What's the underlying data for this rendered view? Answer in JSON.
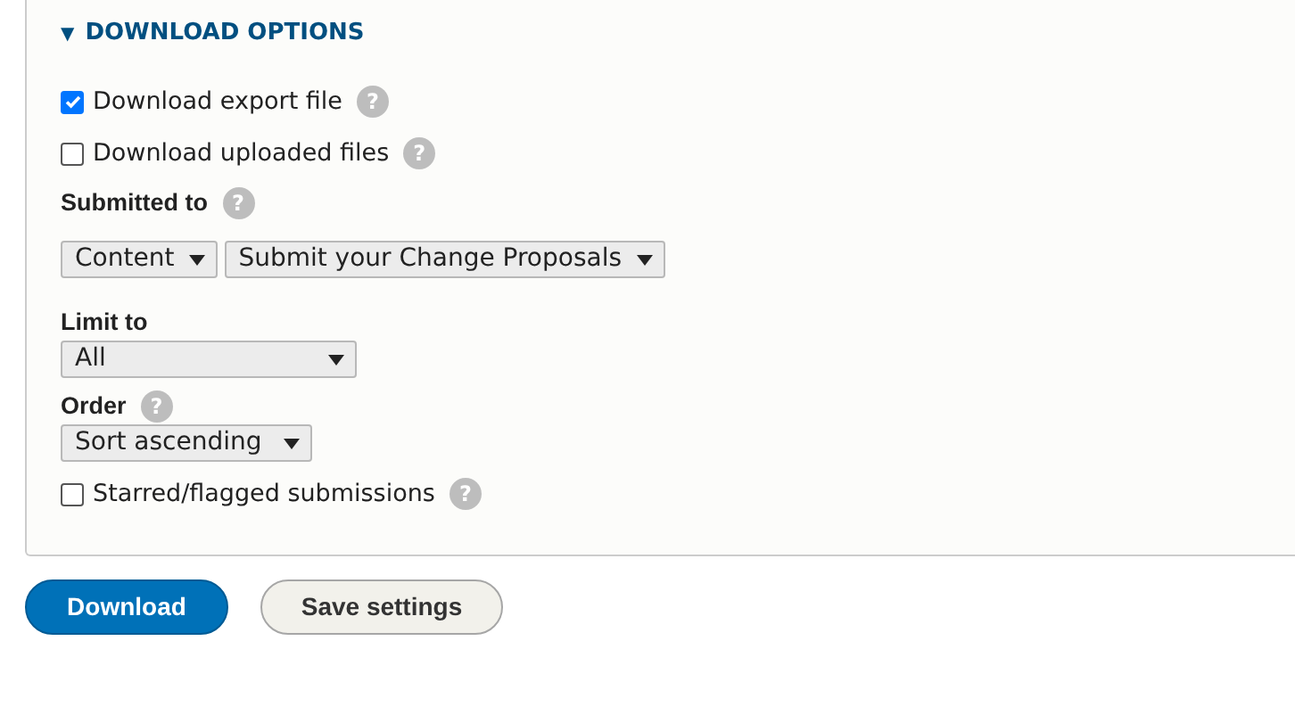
{
  "section": {
    "title": "DOWNLOAD OPTIONS",
    "expanded": true,
    "toggle": "▼"
  },
  "options": [
    {
      "kind": "checkbox",
      "label": "Download export file",
      "checked": true,
      "help": "?"
    },
    {
      "kind": "checkbox",
      "label": "Download uploaded files",
      "checked": false,
      "help": "?"
    },
    {
      "kind": "selects",
      "label": "Submitted to",
      "help": "?",
      "selects": [
        "Content",
        "Submit your Change Proposals"
      ]
    },
    {
      "kind": "select",
      "label": "Limit to",
      "value": "All"
    },
    {
      "kind": "select",
      "label": "Order",
      "help": "?",
      "value": "Sort ascending"
    },
    {
      "kind": "checkbox",
      "label": "Starred/flagged submissions",
      "checked": false,
      "help": "?"
    }
  ],
  "buttons": [
    {
      "label": "Download",
      "primary": true
    },
    {
      "label": "Save settings",
      "primary": false
    }
  ]
}
